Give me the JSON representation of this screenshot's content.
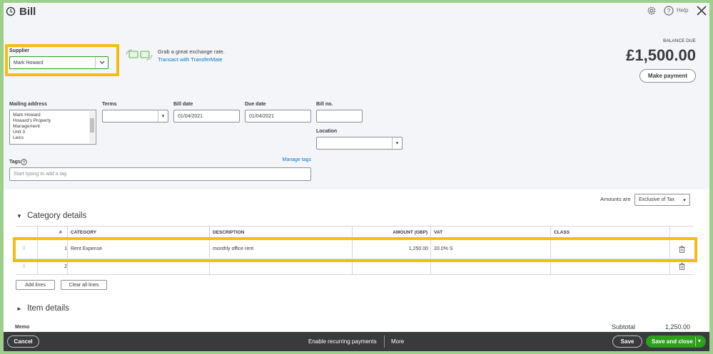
{
  "header": {
    "title": "Bill",
    "help_label": "Help"
  },
  "supplier": {
    "label": "Supplier",
    "value": "Mark Howard"
  },
  "transfermate": {
    "promo": "Grab a great exchange rate.",
    "link": "Transact with TransferMate"
  },
  "balance": {
    "label": "BALANCE DUE",
    "amount": "£1,500.00",
    "make_payment": "Make payment"
  },
  "mailing": {
    "label": "Mailing address",
    "lines": [
      "Mark Howard",
      "Howard's Property",
      "Management",
      "Unit 3",
      "Leics"
    ]
  },
  "terms": {
    "label": "Terms",
    "value": ""
  },
  "bill_date": {
    "label": "Bill date",
    "value": "01/04/2021"
  },
  "due_date": {
    "label": "Due date",
    "value": "01/04/2021"
  },
  "bill_no": {
    "label": "Bill no.",
    "value": ""
  },
  "location": {
    "label": "Location",
    "value": ""
  },
  "tags": {
    "label": "Tags",
    "manage": "Manage tags",
    "placeholder": "Start typing to add a tag"
  },
  "amounts_are": {
    "label": "Amounts are",
    "value": "Exclusive of Tax"
  },
  "category_details": {
    "title": "Category details",
    "columns": [
      "#",
      "CATEGORY",
      "DESCRIPTION",
      "AMOUNT (GBP)",
      "VAT",
      "CLASS"
    ],
    "rows": [
      {
        "num": "1",
        "category": "Rent Expense",
        "description": "monthly office rent",
        "amount": "1,250.00",
        "vat": "20.0% S",
        "class": ""
      },
      {
        "num": "2",
        "category": "",
        "description": "",
        "amount": "",
        "vat": "",
        "class": ""
      }
    ],
    "add_lines": "Add lines",
    "clear_all_lines": "Clear all lines"
  },
  "item_details": {
    "title": "Item details"
  },
  "memo": {
    "label": "Memo"
  },
  "subtotal": {
    "label": "Subtotal",
    "value": "1,250.00"
  },
  "footer": {
    "cancel": "Cancel",
    "recurring": "Enable recurring payments",
    "more": "More",
    "save": "Save",
    "save_close": "Save and close"
  },
  "colors": {
    "highlight": "#f6bb14",
    "primary_green": "#2ca01c",
    "link_blue": "#0077c5",
    "footer_bg": "#393a3d"
  },
  "icons": [
    "history-icon",
    "gear-icon",
    "help-icon",
    "close-icon",
    "exchange-icon",
    "delete-icon",
    "drag-handle-icon",
    "chevron-down-icon",
    "info-icon"
  ]
}
